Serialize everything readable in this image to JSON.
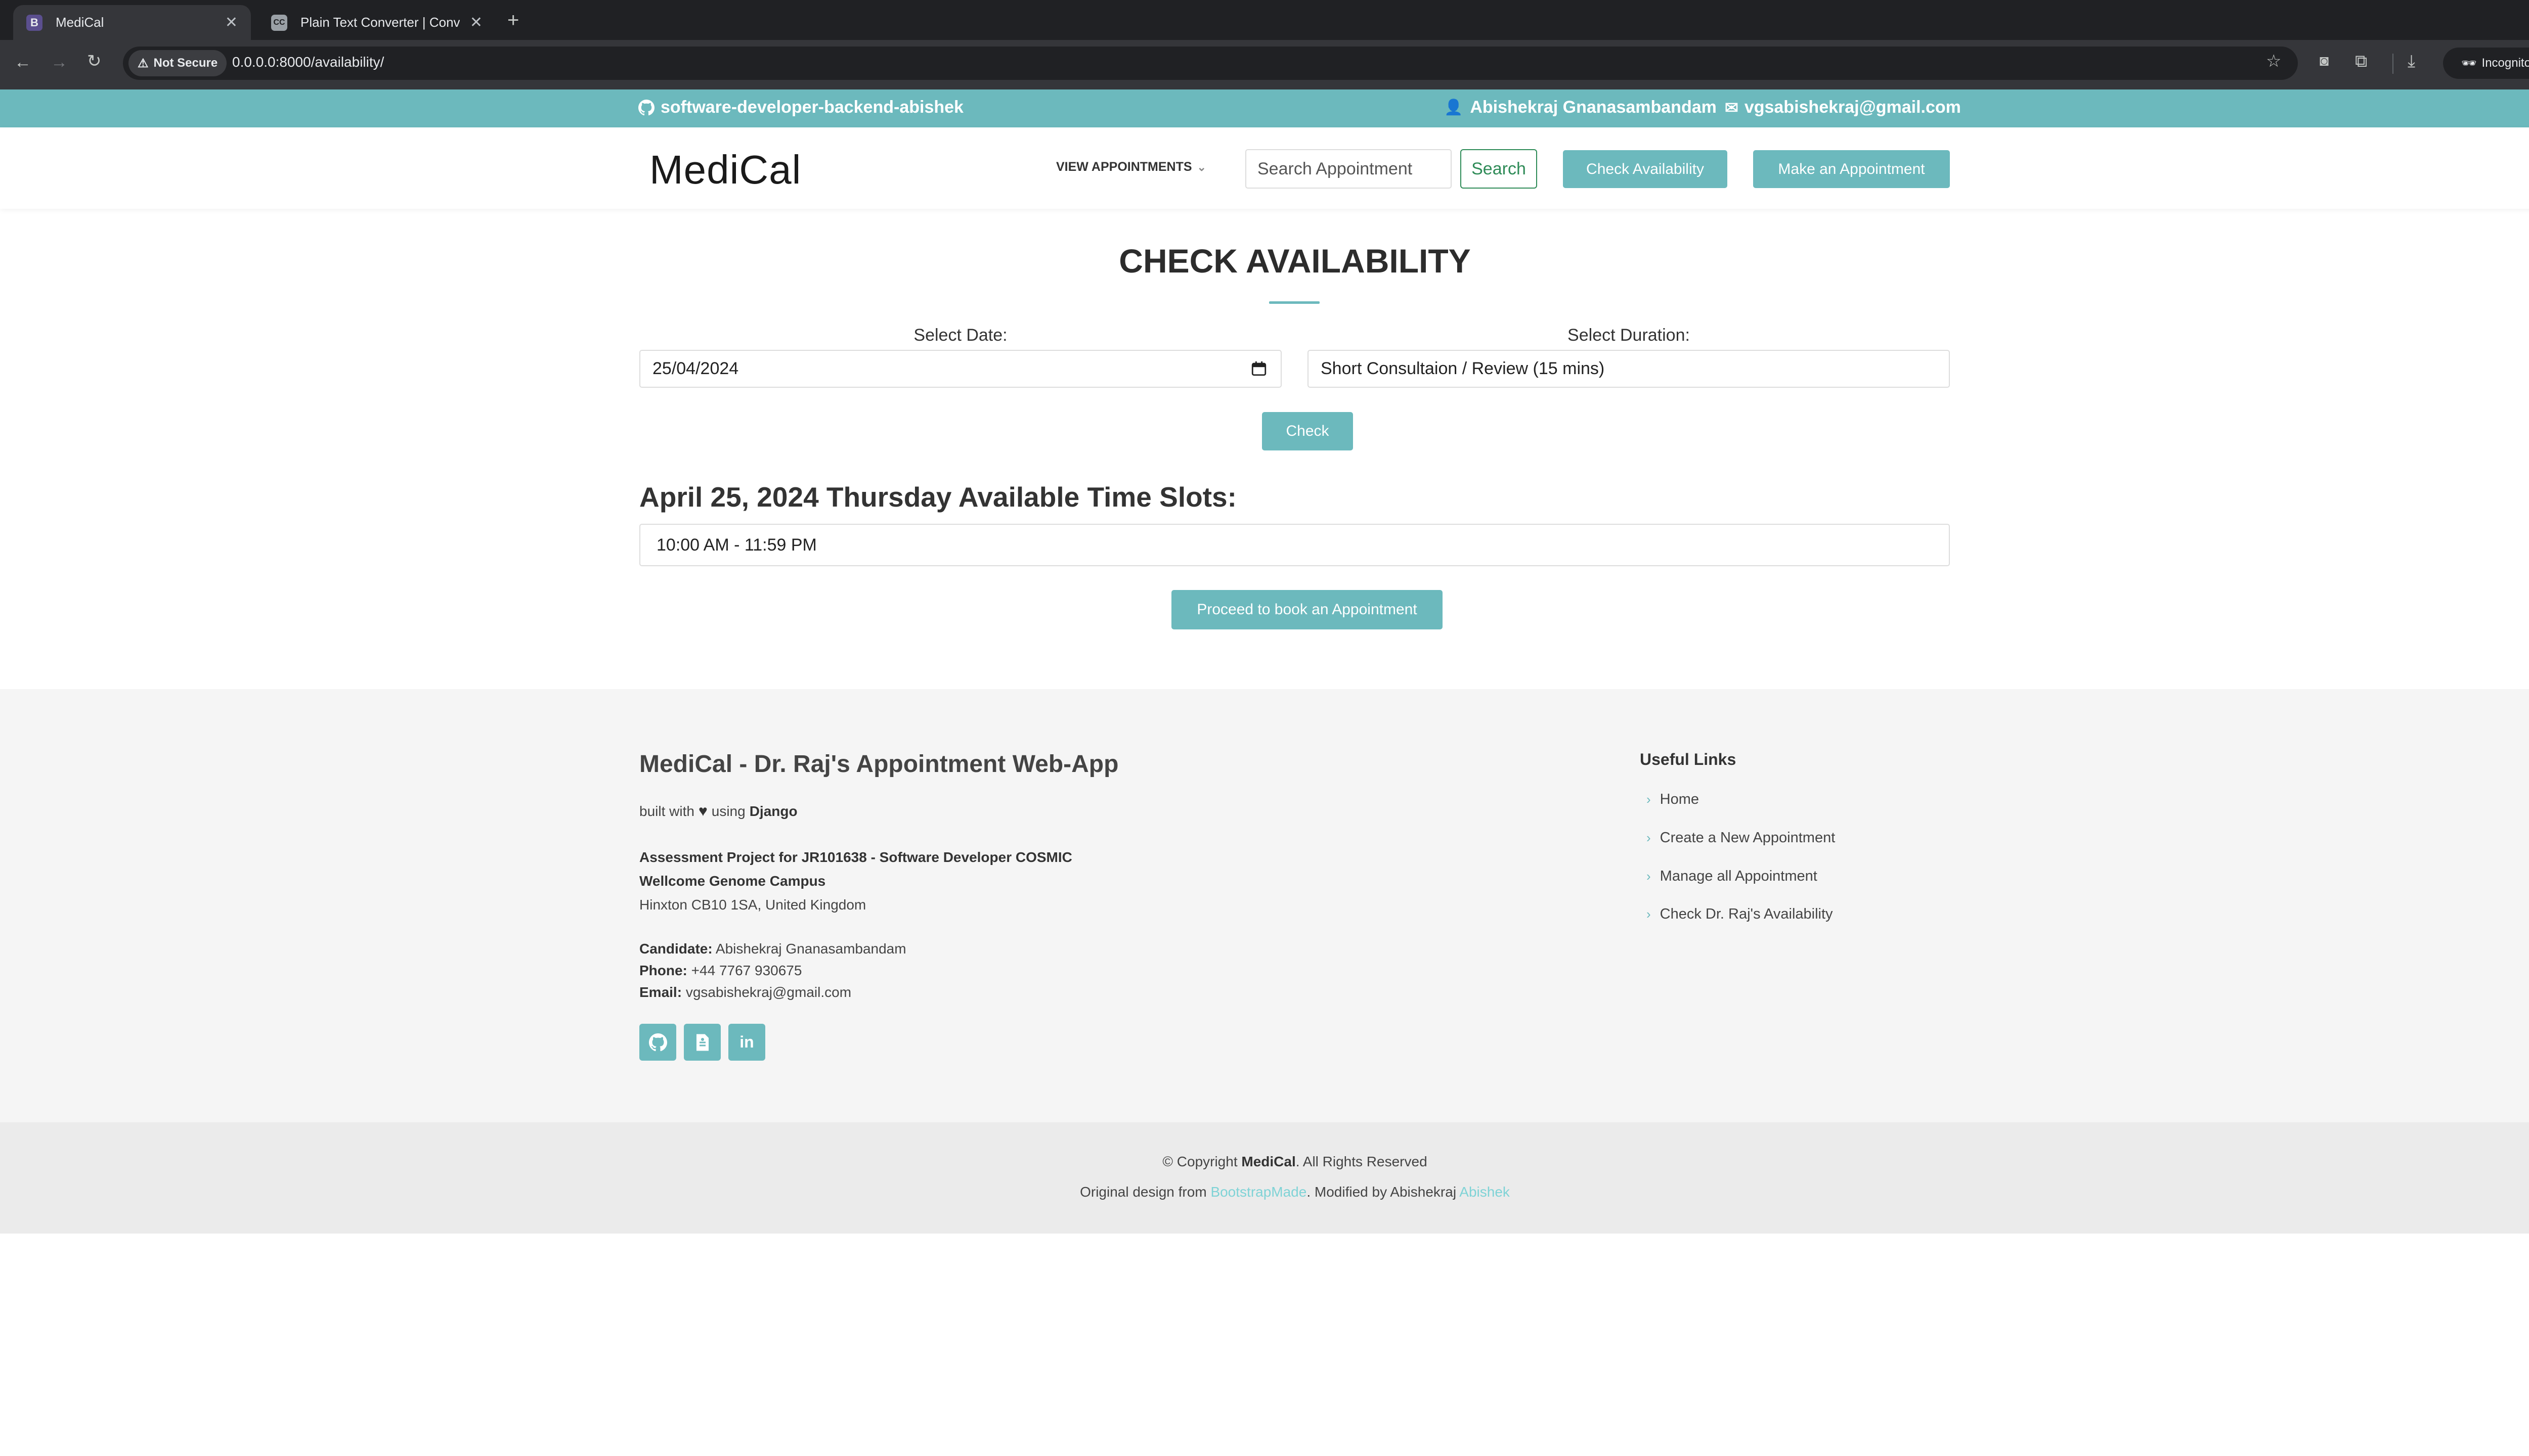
{
  "browser": {
    "tabs": [
      {
        "favicon": "B",
        "title": "MediCal",
        "active": true
      },
      {
        "favicon": "CC",
        "title": "Plain Text Converter | Convert"
      }
    ],
    "security_label": "Not Secure",
    "url": "0.0.0.0:8000/availability/",
    "incognito_label": "Incognito"
  },
  "topbar": {
    "github_user": "software-developer-backend-abishek",
    "doctor_name": "Abishekraj Gnanasambandam",
    "email": "vgsabishekraj@gmail.com"
  },
  "header": {
    "logo": "MediCal",
    "view_appointments": "VIEW APPOINTMENTS",
    "search_placeholder": "Search Appointment",
    "search_button": "Search",
    "check_availability_button": "Check Availability",
    "make_appointment_button": "Make an Appointment"
  },
  "main": {
    "title": "CHECK AVAILABILITY",
    "date_label": "Select Date:",
    "date_value": "25/04/2024",
    "duration_label": "Select Duration:",
    "duration_value": "Short Consultaion / Review (15 mins)",
    "check_button": "Check",
    "slots_heading": "April 25, 2024 Thursday Available Time Slots:",
    "slots": [
      "10:00 AM - 11:59 PM"
    ],
    "proceed_button": "Proceed to book an Appointment"
  },
  "footer": {
    "app_title": "MediCal - Dr. Raj's Appointment Web-App",
    "built_with": "built with",
    "using": "using",
    "framework": "Django",
    "project_line": "Assessment Project for JR101638 - Software Developer COSMIC",
    "campus": "Wellcome Genome Campus",
    "address": "Hinxton CB10 1SA, United Kingdom",
    "candidate_label": "Candidate:",
    "candidate": "Abishekraj Gnanasambandam",
    "phone_label": "Phone:",
    "phone": "+44 7767 930675",
    "email_label": "Email:",
    "email": "vgsabishekraj@gmail.com",
    "useful_links_title": "Useful Links",
    "links": [
      "Home",
      "Create a New Appointment",
      "Manage all Appointment",
      "Check Dr. Raj's Availability"
    ],
    "copyright_prefix": "© Copyright",
    "copyright_brand": "MediCal",
    "copyright_suffix": ". All Rights Reserved",
    "design_prefix": "Original design from",
    "design_link": "BootstrapMade",
    "modified_by": ". Modified by Abishekraj",
    "author_link": "Abishek"
  },
  "colors": {
    "accent": "#6cb9bd",
    "chrome_dark": "#202124",
    "chrome_toolbar": "#35363a",
    "footer_bg": "#f5f5f5"
  }
}
